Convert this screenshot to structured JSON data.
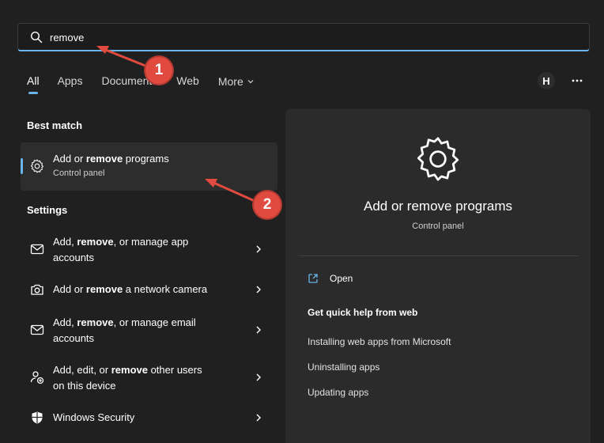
{
  "search": {
    "value": "remove",
    "placeholder": ""
  },
  "tabs": [
    {
      "label": "All"
    },
    {
      "label": "Apps"
    },
    {
      "label": "Documents"
    },
    {
      "label": "Web"
    },
    {
      "label": "More"
    }
  ],
  "user": {
    "initial": "H"
  },
  "sections": {
    "best_match": "Best match",
    "settings": "Settings"
  },
  "best_match": {
    "title_pre": "Add or ",
    "title_bold": "remove",
    "title_post": " programs",
    "subtitle": "Control panel",
    "icon": "gear-icon"
  },
  "settings": [
    {
      "pre": "Add, ",
      "bold": "remove",
      "post": ", or manage app",
      "line2": "accounts",
      "icon": "mail-icon"
    },
    {
      "pre": "Add or ",
      "bold": "remove",
      "post": " a network camera",
      "line2": "",
      "icon": "camera-icon"
    },
    {
      "pre": "Add, ",
      "bold": "remove",
      "post": ", or manage email",
      "line2": "accounts",
      "icon": "mail-icon"
    },
    {
      "pre": "Add, edit, or ",
      "bold": "remove",
      "post": " other users",
      "line2": "on this device",
      "icon": "add-user-icon"
    },
    {
      "pre": "Windows Security",
      "bold": "",
      "post": "",
      "line2": "",
      "icon": "shield-icon"
    }
  ],
  "detail": {
    "title": "Add or remove programs",
    "subtitle": "Control panel",
    "open_label": "Open",
    "quick_help_title": "Get quick help from web",
    "links": [
      "Installing web apps from Microsoft",
      "Uninstalling apps",
      "Updating apps"
    ]
  },
  "annotations": [
    {
      "number": "1"
    },
    {
      "number": "2"
    }
  ],
  "colors": {
    "accent": "#6ab6ea",
    "annotation": "#e04a3f",
    "background": "#202020",
    "panel": "#2b2b2b"
  }
}
